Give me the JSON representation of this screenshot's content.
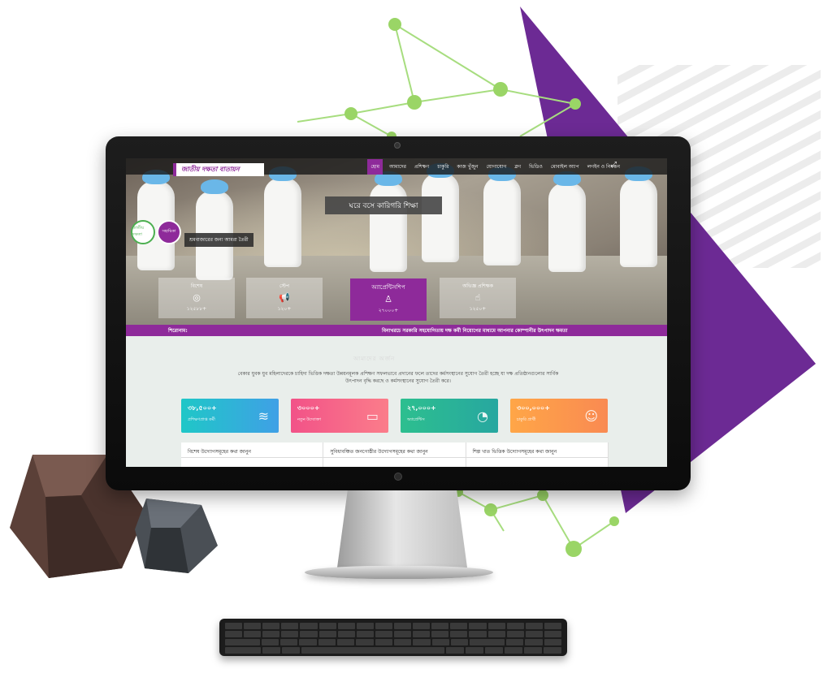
{
  "colors": {
    "brand_purple": "#8e2a9a",
    "network_green": "#8bd35b",
    "card_teal": "#1fc7c7",
    "card_pink": "#f25288",
    "card_green": "#2dbf8f",
    "card_orange": "#ffa647"
  },
  "site": {
    "logo_text": "জাতীয় দক্ষতা বাতায়ন",
    "nav": [
      "হোম",
      "আমাদের",
      "প্রশিক্ষণ",
      "চাকুরি",
      "কাজ খুঁজুন",
      "যোগাযোগ",
      "ব্লগ",
      "ভিডিও",
      "মোবাইল অ্যাপ",
      "লগইন ও নিবন্ধন"
    ],
    "expand_icon": "expand-icon"
  },
  "hero": {
    "banner": "ঘরে বসে কারিগরি শিক্ষা",
    "badge_left": "জাতীয় দক্ষতা",
    "badge_right": "সহায়িকা",
    "tagline": "শ্রমবাজারের জন্য আমরা তৈরী",
    "tiles": [
      {
        "label": "বিশেষ",
        "icon": "target-icon",
        "value": "১২৫৮৮+"
      },
      {
        "label": "স্টেপ",
        "icon": "megaphone-icon",
        "value": "১২০+"
      },
      {
        "label": "অ্যাপ্রেন্টিসশিপ",
        "icon": "person-icon",
        "value": "২৭০০০+"
      },
      {
        "label": "অভিজ্ঞ প্রশিক্ষক",
        "icon": "hand-icon",
        "value": "১২৫০+"
      }
    ]
  },
  "ticker": {
    "label": "শিরোনাম:",
    "text": "বিনাখরচে সরকারি সহযোগিতায় দক্ষ কর্মী নিয়োগের মাধ্যমে আপনার কোম্পানীর উৎপাদন ক্ষমতা"
  },
  "section": {
    "title": "আমাদের অর্জন",
    "description": "বেকার যুবক যুব মহিলাদেরকে চাহিদা ভিত্তিক দক্ষতা উন্নয়নমূলক প্রশিক্ষণ সফলভাবে প্রদানের ফলে তাদের কর্মসংস্থানের সুযোগ তৈরী হচ্ছে যা দক্ষ প্রতিষ্ঠানগুলোর সার্বিক উৎপাদন বৃদ্ধি করছে ও কর্মসংস্থানের সুযোগ তৈরী করে।",
    "cards": [
      {
        "value": "৩৮,৫০০+",
        "label": "প্রশিক্ষণপ্রাপ্ত কর্মী",
        "icon": "layers-icon"
      },
      {
        "value": "৩০০০+",
        "label": "নতুন উদ্যোক্তা",
        "icon": "wallet-icon"
      },
      {
        "value": "২৭,০০০+",
        "label": "অ্যাপ্রেন্টিস",
        "icon": "pie-chart-icon"
      },
      {
        "value": "৩০০,০০০+",
        "label": "চাকুরি প্রার্থী",
        "icon": "user-icon"
      }
    ],
    "tabs": [
      "বিশেষ উদ্যোগসমূহের কথা জানুন",
      "সুবিধাবঞ্চিত জনগোষ্ঠীর উদ্যোগসমূহের কথা জানুন",
      "শিল্প খাত ভিত্তিক উদ্যোগসমূহের কথা জানুন"
    ]
  }
}
